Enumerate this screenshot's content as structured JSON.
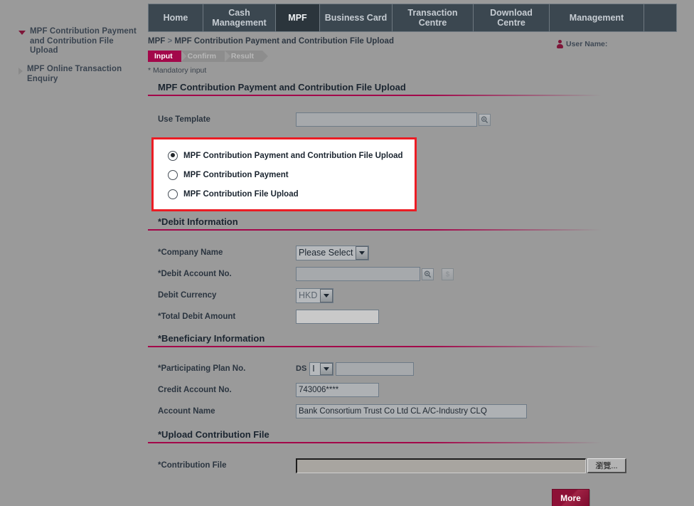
{
  "nav": {
    "items": [
      {
        "label": "Home",
        "active": false,
        "key": "home"
      },
      {
        "label": "Cash Management",
        "active": false,
        "key": "cash-management"
      },
      {
        "label": "MPF",
        "active": true,
        "key": "mpf"
      },
      {
        "label": "Business Card",
        "active": false,
        "key": "business-card"
      },
      {
        "label": "Transaction Centre",
        "active": false,
        "key": "transaction-centre"
      },
      {
        "label": "Download Centre",
        "active": false,
        "key": "download-centre"
      },
      {
        "label": "Management",
        "active": false,
        "key": "management"
      }
    ]
  },
  "sidebar": {
    "items": [
      {
        "label": "MPF Contribution Payment and Contribution File Upload",
        "expanded": true
      },
      {
        "label": "MPF Online Transaction Enquiry",
        "expanded": false
      }
    ]
  },
  "header": {
    "breadcrumb_root": "MPF",
    "breadcrumb_sep": ">",
    "breadcrumb_current": "MPF Contribution Payment and Contribution File Upload",
    "user_label": "User Name:",
    "mandatory_note": "* Mandatory input"
  },
  "steps": [
    {
      "label": "Input",
      "state": "active"
    },
    {
      "label": "Confirm",
      "state": "idle"
    },
    {
      "label": "Result",
      "state": "idle"
    }
  ],
  "main": {
    "title": "MPF Contribution Payment and Contribution File Upload",
    "use_template": {
      "label": "Use Template",
      "value": "",
      "placeholder": "",
      "search_icon": "magnifier-icon"
    },
    "options": [
      {
        "label": "MPF Contribution Payment and Contribution File Upload",
        "selected": true
      },
      {
        "label": "MPF Contribution Payment",
        "selected": false
      },
      {
        "label": "MPF Contribution File Upload",
        "selected": false
      }
    ],
    "debit": {
      "section_title": "*Debit Information",
      "company_name": {
        "label": "*Company Name",
        "value": "Please Select"
      },
      "debit_account": {
        "label": "*Debit Account No.",
        "value": "",
        "search_icon": "magnifier-icon",
        "balance_icon": "dollar-icon"
      },
      "debit_currency": {
        "label": "Debit Currency",
        "value": "HKD"
      },
      "total_debit_amount": {
        "label": "*Total Debit Amount",
        "value": ""
      }
    },
    "beneficiary": {
      "section_title": "*Beneficiary Information",
      "plan_no": {
        "label": "*Participating Plan No.",
        "prefix": "DS",
        "select_value": "I",
        "value": ""
      },
      "credit_account": {
        "label": "Credit Account No.",
        "value": "743006****"
      },
      "account_name": {
        "label": "Account Name",
        "value": "Bank Consortium Trust Co Ltd CL A/C-Industry CLQ"
      }
    },
    "upload": {
      "section_title": "*Upload Contribution File",
      "file": {
        "label": "*Contribution File",
        "value": "",
        "browse_label": "瀏覽..."
      }
    },
    "more_button": "More"
  },
  "colors": {
    "accent": "#a3074a",
    "nav_bg": "#3b4750",
    "page_bg": "#9a9a9a",
    "highlight_border": "#ec1c24",
    "more_button": "#8d1036"
  }
}
